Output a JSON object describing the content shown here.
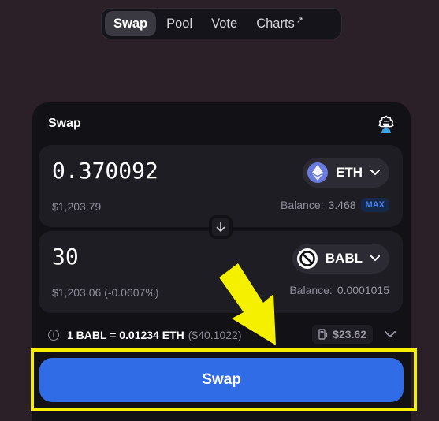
{
  "nav": {
    "tabs": [
      {
        "label": "Swap",
        "active": true
      },
      {
        "label": "Pool",
        "active": false
      },
      {
        "label": "Vote",
        "active": false
      },
      {
        "label": "Charts",
        "active": false,
        "external": true
      }
    ],
    "external_glyph": "↗"
  },
  "card": {
    "title": "Swap",
    "settings_icon": "gear-icon"
  },
  "from": {
    "amount": "0.370092",
    "usd_value": "$1,203.79",
    "balance_label": "Balance:",
    "balance_value": "3.468",
    "max_label": "MAX",
    "token": {
      "symbol": "ETH",
      "icon": "eth-icon",
      "color": "#6a7be0"
    }
  },
  "to": {
    "amount": "30",
    "usd_value": "$1,203.06 (-0.0607%)",
    "balance_label": "Balance:",
    "balance_value": "0.0001015",
    "token": {
      "symbol": "BABL",
      "icon": "babl-icon",
      "color": "#ffffff"
    }
  },
  "rate": {
    "text": "1 BABL = 0.01234 ETH",
    "usd": "($40.1022)",
    "gas_cost": "$23.62"
  },
  "swap_button": {
    "label": "Swap"
  },
  "colors": {
    "accent": "#2f6ce6",
    "highlight": "#f5f000",
    "background": "#2b2028"
  }
}
